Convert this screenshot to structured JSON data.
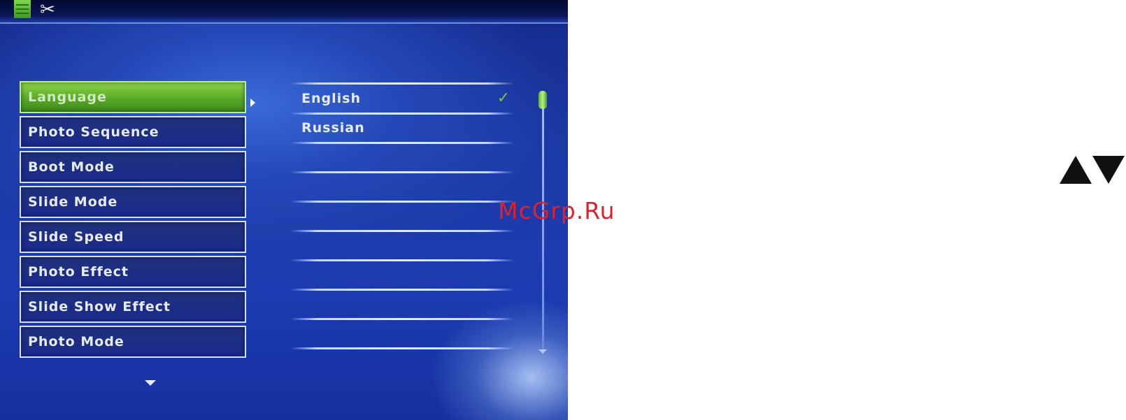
{
  "topbar": {
    "icons": [
      "folder-icon",
      "tools-icon"
    ]
  },
  "menu": {
    "items": [
      {
        "label": "Language",
        "selected": true
      },
      {
        "label": "Photo  Sequence",
        "selected": false
      },
      {
        "label": "Boot  Mode",
        "selected": false
      },
      {
        "label": "Slide  Mode",
        "selected": false
      },
      {
        "label": "Slide  Speed",
        "selected": false
      },
      {
        "label": "Photo  Effect",
        "selected": false
      },
      {
        "label": "Slide  Show  Effect",
        "selected": false
      },
      {
        "label": "Photo  Mode",
        "selected": false
      }
    ]
  },
  "options": {
    "items": [
      {
        "label": "English",
        "checked": true
      },
      {
        "label": "Russian",
        "checked": false
      },
      {
        "label": ""
      },
      {
        "label": ""
      },
      {
        "label": ""
      },
      {
        "label": ""
      },
      {
        "label": ""
      },
      {
        "label": ""
      },
      {
        "label": ""
      }
    ],
    "check_glyph": "✓"
  },
  "watermark": "McGrp.Ru",
  "colors": {
    "selected_item": "#59a828",
    "menu_item": "#1a2a8c",
    "watermark": "#e0202a"
  }
}
